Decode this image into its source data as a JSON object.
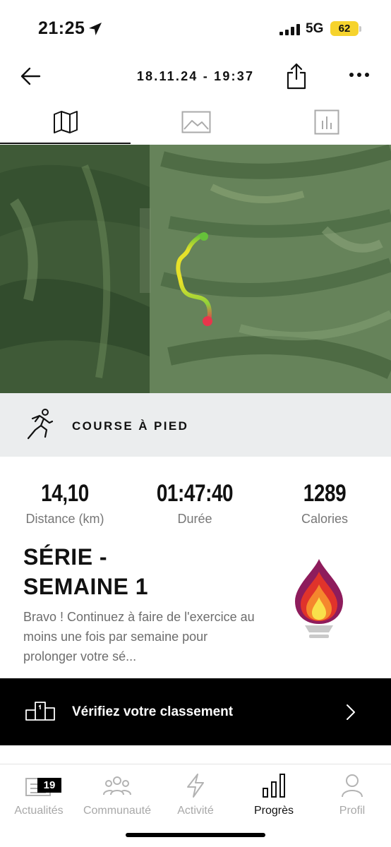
{
  "status_bar": {
    "time": "21:25",
    "network": "5G",
    "battery": "62",
    "icons": [
      "location-arrow-icon",
      "signal-icon",
      "battery-icon"
    ]
  },
  "header": {
    "title": "18.11.24 - 19:37",
    "icons": [
      "back-arrow-icon",
      "share-icon",
      "more-icon"
    ]
  },
  "tabs": [
    {
      "icon": "map-icon",
      "active": true
    },
    {
      "icon": "photo-icon",
      "active": false
    },
    {
      "icon": "bar-chart-icon",
      "active": false
    }
  ],
  "activity": {
    "icon": "running-icon",
    "label": "COURSE À PIED"
  },
  "stats": [
    {
      "value": "14,10",
      "label": "Distance (km)"
    },
    {
      "value": "01:47:40",
      "label": "Durée"
    },
    {
      "value": "1289",
      "label": "Calories"
    }
  ],
  "streak": {
    "title_line1": "SÉRIE -",
    "title_line2": "SEMAINE 1",
    "text": "Bravo ! Continuez à faire de l'exercice au moins une fois par semaine pour prolonger votre sé...",
    "icon": "flame-icon"
  },
  "ranking": {
    "label": "Vérifiez votre classement",
    "icons": [
      "podium-icon",
      "chevron-right-icon"
    ]
  },
  "bottom_nav": {
    "items": [
      {
        "label": "Actualités",
        "icon": "news-icon",
        "badge": "19",
        "active": false
      },
      {
        "label": "Communauté",
        "icon": "community-icon",
        "active": false
      },
      {
        "label": "Activité",
        "icon": "lightning-icon",
        "active": false
      },
      {
        "label": "Progrès",
        "icon": "progress-bars-icon",
        "active": true
      },
      {
        "label": "Profil",
        "icon": "profile-icon",
        "active": false
      }
    ]
  },
  "colors": {
    "route_start": "#66c23a",
    "route_mid": "#e6e12a",
    "route_end": "#e8354b",
    "activity_band": "#ebedee",
    "ranking_bar": "#000000",
    "battery": "#f6d32d"
  }
}
